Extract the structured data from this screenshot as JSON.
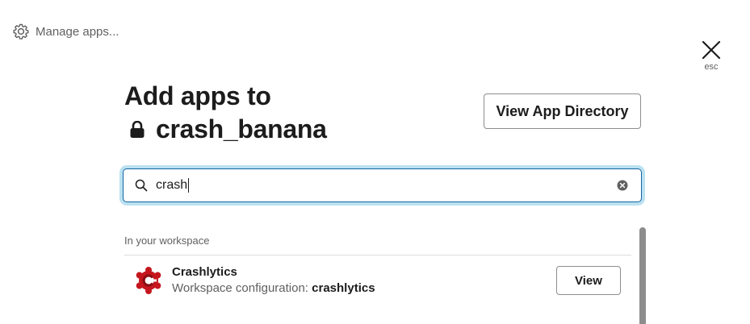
{
  "header": {
    "manage_apps_label": "Manage apps...",
    "close_hint": "esc"
  },
  "title": {
    "line1": "Add apps to",
    "channel_name": "crash_banana"
  },
  "view_directory_label": "View App Directory",
  "search": {
    "value": "crash",
    "placeholder": ""
  },
  "results": {
    "section_label": "In your workspace",
    "apps": [
      {
        "name": "Crashlytics",
        "desc_prefix": "Workspace configuration: ",
        "desc_bold": "crashlytics",
        "action_label": "View",
        "logo_color": "#c5161d",
        "icon": "crashlytics-logo-icon"
      }
    ]
  },
  "colors": {
    "focus_ring": "#1d9bd1",
    "text_primary": "#1d1c1d",
    "text_secondary": "#616061"
  }
}
